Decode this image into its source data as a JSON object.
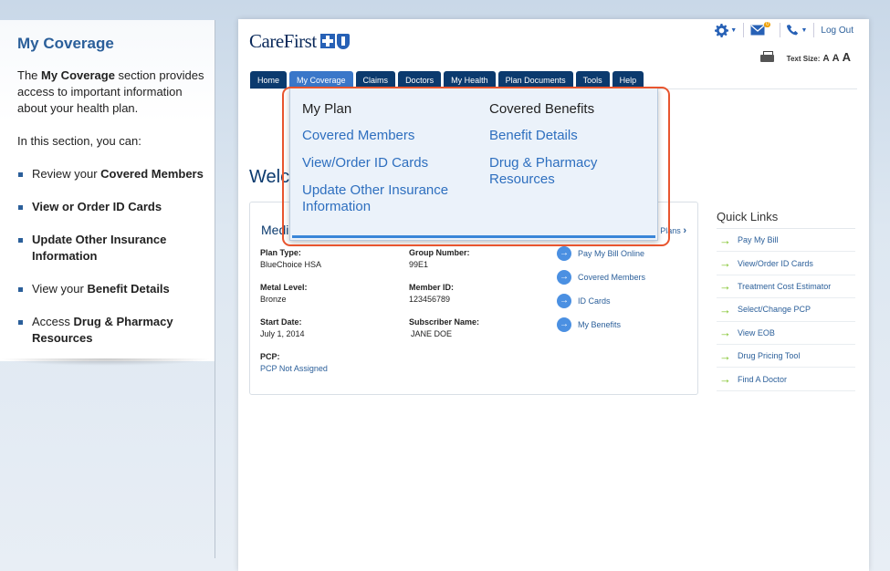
{
  "sidebar": {
    "title": "My Coverage",
    "intro_pre": "The ",
    "intro_bold": "My Coverage",
    "intro_post": " section provides access to important information about your health plan.",
    "lead": "In this section, you can:",
    "items": [
      {
        "pre": "Review your ",
        "bold": "Covered Members",
        "post": ""
      },
      {
        "pre": "",
        "bold": "View or Order ID Cards",
        "post": ""
      },
      {
        "pre": "",
        "bold": "Update Other Insurance Information",
        "post": ""
      },
      {
        "pre": "View your ",
        "bold": "Benefit Details",
        "post": ""
      },
      {
        "pre": "Access ",
        "bold": "Drug & Pharmacy Resources",
        "post": ""
      }
    ]
  },
  "header": {
    "logo": "CareFirst",
    "mail_badge": "0",
    "logout": "Log Out",
    "text_size_label": "Text Size:",
    "text_size_a": "A"
  },
  "nav": {
    "tabs": [
      "Home",
      "My Coverage",
      "Claims",
      "Doctors",
      "My Health",
      "Plan Documents",
      "Tools",
      "Help"
    ],
    "active": "My Coverage"
  },
  "dropdown": {
    "col1_head": "My Plan",
    "col1_links": [
      "Covered Members",
      "View/Order ID Cards",
      "Update Other Insurance Information"
    ],
    "col2_head": "Covered Benefits",
    "col2_links": [
      "Benefit Details",
      "Drug & Pharmacy Resources"
    ]
  },
  "main": {
    "welcome": "Welc",
    "card_title": "Medi",
    "other_plans": "Plans",
    "fields": {
      "plan_type_label": "Plan Type:",
      "plan_type": "BlueChoice HSA",
      "group_label": "Group Number:",
      "group": "99E1",
      "metal_label": "Metal Level:",
      "metal": "Bronze",
      "member_label": "Member ID:",
      "member": "123456789",
      "start_label": "Start Date:",
      "start": "July 1, 2014",
      "subscriber_label": "Subscriber Name:",
      "subscriber": "JANE DOE",
      "pcp_label": "PCP:",
      "pcp": "PCP Not Assigned"
    },
    "actions": [
      "Pay My Bill Online",
      "Covered Members",
      "ID Cards",
      "My Benefits"
    ]
  },
  "quick_links": {
    "title": "Quick Links",
    "items": [
      "Pay My Bill",
      "View/Order ID Cards",
      "Treatment Cost Estimator",
      "Select/Change PCP",
      "View EOB",
      "Drug Pricing Tool",
      "Find A Doctor"
    ]
  }
}
